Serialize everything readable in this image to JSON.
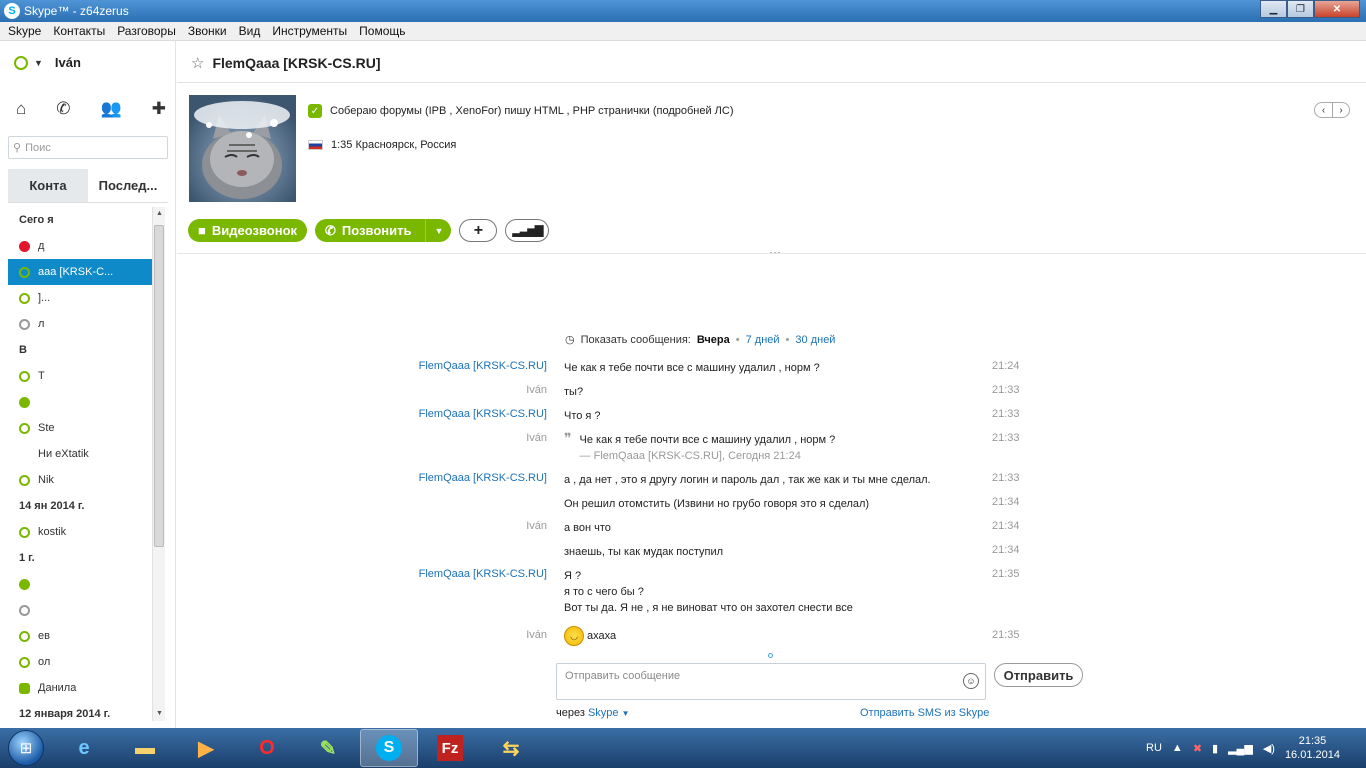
{
  "window": {
    "title": "Skype™ - z64zerus"
  },
  "menu": [
    "Skype",
    "Контакты",
    "Разговоры",
    "Звонки",
    "Вид",
    "Инструменты",
    "Помощь"
  ],
  "sidebar": {
    "user_name": "Iván",
    "search_placeholder": "Поис",
    "tabs": [
      "Конта",
      "Послед..."
    ],
    "contacts": [
      {
        "type": "group",
        "label": "Сего   я"
      },
      {
        "type": "item",
        "label": "д",
        "status": "red"
      },
      {
        "type": "item",
        "label": "    aaa [KRSK-C...",
        "status": "online",
        "selected": true
      },
      {
        "type": "item",
        "label": "                ]...",
        "status": "online"
      },
      {
        "type": "item",
        "label": "л",
        "status": "grey"
      },
      {
        "type": "group",
        "label": "В"
      },
      {
        "type": "item",
        "label": "Т",
        "status": "online"
      },
      {
        "type": "item",
        "label": "",
        "status": "green"
      },
      {
        "type": "item",
        "label": "Ste",
        "status": "online"
      },
      {
        "type": "item",
        "label": "Ни     eXtatik",
        "status": "none"
      },
      {
        "type": "item",
        "label": "Nik",
        "status": "online"
      },
      {
        "type": "group",
        "label": "14 ян       2014 г."
      },
      {
        "type": "item",
        "label": "               kostik",
        "status": "online"
      },
      {
        "type": "group",
        "label": "1                 г."
      },
      {
        "type": "item",
        "label": "",
        "status": "green"
      },
      {
        "type": "item",
        "label": "",
        "status": "grey"
      },
      {
        "type": "item",
        "label": "                   ев",
        "status": "online"
      },
      {
        "type": "item",
        "label": "ол",
        "status": "online"
      },
      {
        "type": "item",
        "label": "Данила",
        "status": "check"
      },
      {
        "type": "group",
        "label": "12 января 2014 г."
      }
    ]
  },
  "chat": {
    "contact_name": "FlemQaaa [KRSK-CS.RU]",
    "mood": "Собераю форумы (IPB , XenoFor) пишу HTML , PHP странички (подробней ЛС)",
    "location": "1:35 Красноярск, Россия",
    "video_call_label": "Видеозвонок",
    "call_label": "Позвонить",
    "show_messages": {
      "label": "Показать сообщения:",
      "current": "Вчера",
      "opt1": "7 дней",
      "opt2": "30 дней"
    },
    "messages": [
      {
        "who": "FlemQaaa [KRSK-CS.RU]",
        "me": false,
        "lines": [
          "Че как я тебе почти все с машину удалил , норм ?"
        ],
        "time": "21:24"
      },
      {
        "who": "Iván",
        "me": true,
        "lines": [
          "ты?"
        ],
        "time": "21:33"
      },
      {
        "who": "FlemQaaa [KRSK-CS.RU]",
        "me": false,
        "lines": [
          "Что я ?"
        ],
        "time": "21:33"
      },
      {
        "who": "Iván",
        "me": true,
        "quote": "Че как я тебе почти все с машину удалил , норм ?",
        "quote_src": "— FlemQaaa [KRSK-CS.RU], Сегодня 21:24",
        "time": "21:33"
      },
      {
        "who": "FlemQaaa [KRSK-CS.RU]",
        "me": false,
        "lines": [
          "а , да нет , это я другу логин и пароль дал , так же как и ты мне сделал."
        ],
        "time": "21:33"
      },
      {
        "who": "",
        "me": false,
        "lines": [
          "Он решил отомстить (Извини но грубо говоря это я сделал)"
        ],
        "time": "21:34"
      },
      {
        "who": "Iván",
        "me": true,
        "lines": [
          "а вон что"
        ],
        "time": "21:34"
      },
      {
        "who": "",
        "me": true,
        "lines": [
          "знаешь, ты как мудак поступил"
        ],
        "time": "21:34"
      },
      {
        "who": "FlemQaaa [KRSK-CS.RU]",
        "me": false,
        "lines": [
          "Я ?",
          "я то с чего бы ?",
          "Вот ты да. Я не , я не виноват что он захотел снести все"
        ],
        "time": "21:35"
      },
      {
        "who": "Iván",
        "me": true,
        "smiley": true,
        "lines": [
          "ахаха"
        ],
        "time": "21:35"
      }
    ],
    "input_placeholder": "Отправить сообщение",
    "send_label": "Отправить",
    "via_label": "через",
    "via_link": "Skype",
    "sms_link": "Отправить SMS из Skype"
  },
  "taskbar": {
    "lang": "RU",
    "time": "21:35",
    "date": "16.01.2014"
  }
}
